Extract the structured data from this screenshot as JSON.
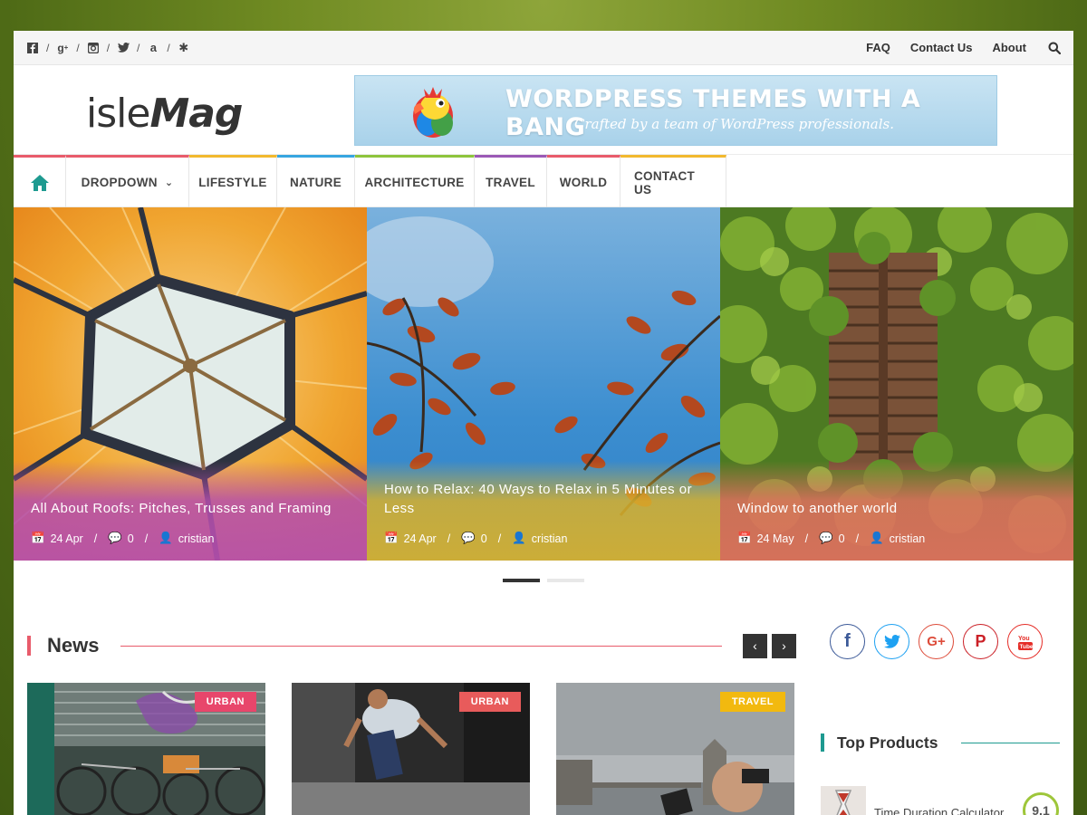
{
  "topbar": {
    "social_icons": [
      "facebook-icon",
      "google-plus-icon",
      "instagram-icon",
      "twitter-icon",
      "amazon-icon",
      "yelp-icon"
    ],
    "separator": "/",
    "links": [
      "FAQ",
      "Contact Us",
      "About"
    ]
  },
  "header": {
    "logo_part1": "isle",
    "logo_part2": "Mag",
    "banner_title": "WORDPRESS THEMES WITH A BANG",
    "banner_subtitle": "Crafted by a team of WordPress professionals."
  },
  "nav": {
    "items": [
      {
        "label": "DROPDOWN",
        "color": "#e85b6b",
        "has_dropdown": true
      },
      {
        "label": "LIFESTYLE",
        "color": "#f2b92e"
      },
      {
        "label": "NATURE",
        "color": "#37a6e0"
      },
      {
        "label": "ARCHITECTURE",
        "color": "#8ec43d"
      },
      {
        "label": "TRAVEL",
        "color": "#9b59b6"
      },
      {
        "label": "WORLD",
        "color": "#e85b6b"
      },
      {
        "label": "CONTACT US",
        "color": "#f2b92e"
      }
    ],
    "home_color": "#1e9a90"
  },
  "slider": {
    "slides": [
      {
        "title": "All About Roofs: Pitches, Trusses and Framing",
        "date": "24 Apr",
        "comments": "0",
        "author": "cristian",
        "overlay_color": "#b54fae"
      },
      {
        "title": "How to Relax: 40 Ways to Relax in 5 Minutes or Less",
        "date": "24 Apr",
        "comments": "0",
        "author": "cristian",
        "overlay_color": "#d9b12c"
      },
      {
        "title": "Window to another world",
        "date": "24 May",
        "comments": "0",
        "author": "cristian",
        "overlay_color": "#e0705f"
      }
    ]
  },
  "news": {
    "title": "News",
    "prev": "‹",
    "next": "›",
    "cards": [
      {
        "badge": "URBAN",
        "badge_color": "#e8466b"
      },
      {
        "badge": "URBAN",
        "badge_color": "#e85b5b"
      },
      {
        "badge": "TRAVEL",
        "badge_color": "#f2b90f"
      }
    ]
  },
  "sidebar": {
    "social": [
      {
        "name": "facebook",
        "glyph": "f",
        "color": "#3b5998"
      },
      {
        "name": "twitter",
        "glyph": "t",
        "color": "#1da1f2"
      },
      {
        "name": "google-plus",
        "glyph": "G+",
        "color": "#dd4b39"
      },
      {
        "name": "pinterest",
        "glyph": "P",
        "color": "#cb2027"
      },
      {
        "name": "youtube",
        "glyph": "You",
        "color": "#e52d27"
      }
    ],
    "top_products_title": "Top Products",
    "product_name": "Time Duration Calculator",
    "product_score": "9.1"
  }
}
